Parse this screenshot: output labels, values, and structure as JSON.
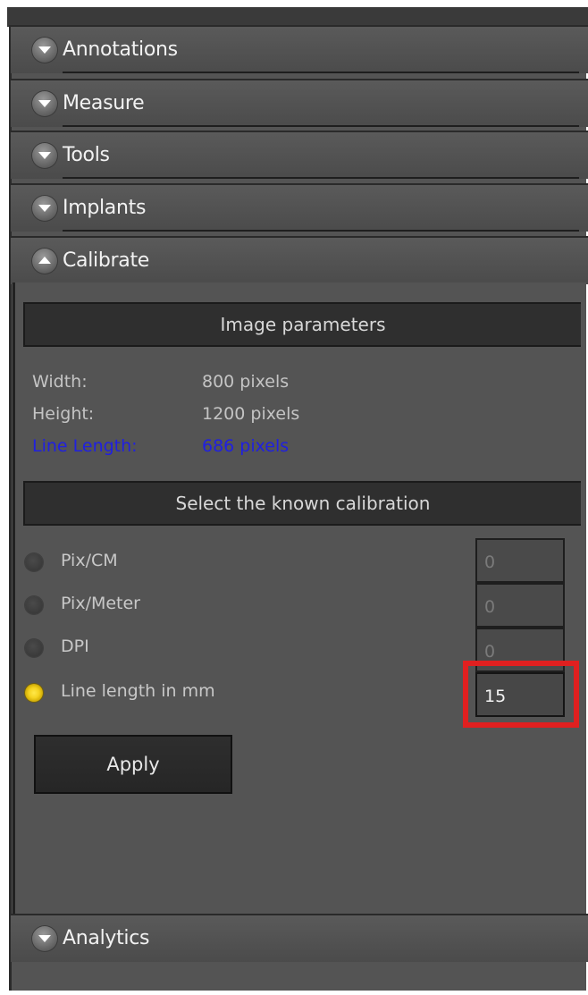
{
  "accordion": {
    "annotations": {
      "label": "Annotations"
    },
    "measure": {
      "label": "Measure"
    },
    "tools": {
      "label": "Tools"
    },
    "implants": {
      "label": "Implants"
    },
    "calibrate": {
      "label": "Calibrate"
    },
    "analytics": {
      "label": "Analytics"
    }
  },
  "calibrate": {
    "image_parameters_title": "Image parameters",
    "params": {
      "width_label": "Width:",
      "width_value": "800 pixels",
      "height_label": "Height:",
      "height_value": "1200 pixels",
      "line_length_label": "Line Length:",
      "line_length_value": "686 pixels"
    },
    "select_title": "Select the known calibration",
    "options": {
      "pix_cm": {
        "label": "Pix/CM",
        "value": "0"
      },
      "pix_meter": {
        "label": "Pix/Meter",
        "value": "0"
      },
      "dpi": {
        "label": "DPI",
        "value": "0"
      },
      "line_mm": {
        "label": "Line length in mm",
        "value": "15"
      }
    },
    "apply_label": "Apply"
  },
  "colors": {
    "panel_bg": "#545454",
    "highlight": "#e02020",
    "line_length_text": "#2020e0",
    "radio_selected": "#f5d320"
  }
}
